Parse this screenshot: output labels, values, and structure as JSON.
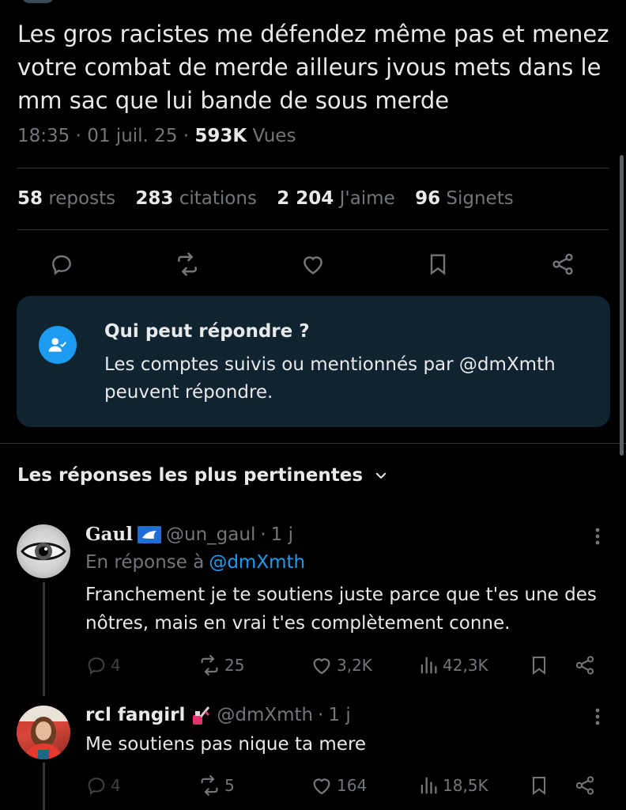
{
  "tweet": {
    "text": "Les gros racistes me défendez même pas et menez votre combat de merde ailleurs jvous mets dans le mm sac que lui bande de sous merde",
    "time": "18:35",
    "date": "01 juil. 25",
    "views_count": "593K",
    "views_label": "Vues"
  },
  "stats": {
    "reposts_count": "58",
    "reposts_label": "reposts",
    "quotes_count": "283",
    "quotes_label": "citations",
    "likes_count": "2 204",
    "likes_label": "J'aime",
    "bookmarks_count": "96",
    "bookmarks_label": "Signets"
  },
  "who_can_reply": {
    "title": "Qui peut répondre ?",
    "body": "Les comptes suivis ou mentionnés par @dmXmth peuvent répondre."
  },
  "replies_section": {
    "sort_label": "Les réponses les plus pertinentes"
  },
  "replies": [
    {
      "display_name": "Gaul",
      "handle": "@un_gaul",
      "age": "1 j",
      "in_reply_prefix": "En réponse à",
      "in_reply_handle": "@dmXmth",
      "text": "Franchement je te soutiens juste parce que t'es une des nôtres, mais en vrai t'es complètement conne.",
      "replies": "4",
      "reposts": "25",
      "likes": "3,2K",
      "views": "42,3K"
    },
    {
      "display_name": "rcl fangirl",
      "handle": "@dmXmth",
      "age": "1 j",
      "text": "Me soutiens pas nique ta mere",
      "replies": "4",
      "reposts": "5",
      "likes": "164",
      "views": "18,5K"
    }
  ],
  "icons": {
    "reply": "reply-icon",
    "repost": "repost-icon",
    "like": "heart-icon",
    "bookmark": "bookmark-icon",
    "share": "share-icon",
    "views": "views-icon",
    "more": "more-dots-icon",
    "chevron": "chevron-down-icon",
    "person_check": "person-check-icon"
  },
  "colors": {
    "accent": "#1d9bf0",
    "muted": "#71767b",
    "text": "#e7e9ea",
    "card_bg": "#0f2430",
    "background": "#000000"
  }
}
